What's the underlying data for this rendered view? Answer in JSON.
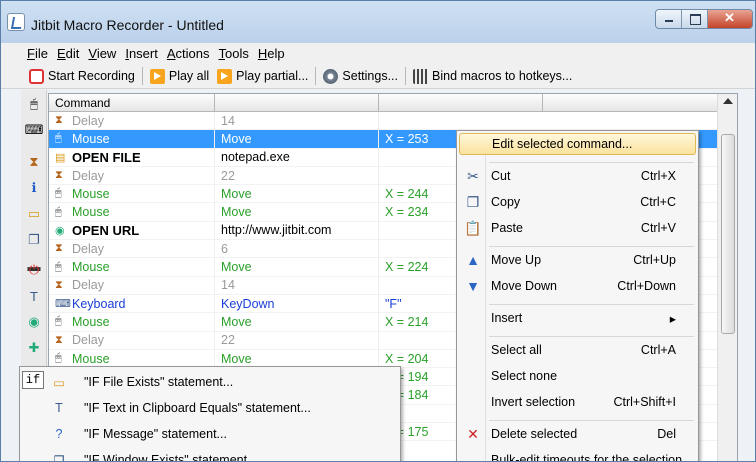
{
  "window": {
    "title": "Jitbit Macro Recorder - Untitled"
  },
  "menu": [
    "File",
    "Edit",
    "View",
    "Insert",
    "Actions",
    "Tools",
    "Help"
  ],
  "toolbar": {
    "start": "Start Recording",
    "play_all": "Play all",
    "play_partial": "Play partial...",
    "settings": "Settings...",
    "bind": "Bind macros to hotkeys..."
  },
  "grid": {
    "header": "Command",
    "rows": [
      {
        "icon": "hourglass-icon",
        "cmd": "Delay",
        "val": "14",
        "extra": "",
        "style": "gray"
      },
      {
        "icon": "mouse-icon",
        "cmd": "Mouse",
        "val": "Move",
        "extra": "X = 253",
        "style": "green",
        "selected": true
      },
      {
        "icon": "folder-icon",
        "cmd": "OPEN FILE",
        "val": "notepad.exe",
        "extra": "",
        "style": "bold"
      },
      {
        "icon": "hourglass-icon",
        "cmd": "Delay",
        "val": "22",
        "extra": "",
        "style": "gray"
      },
      {
        "icon": "mouse-icon",
        "cmd": "Mouse",
        "val": "Move",
        "extra": "X = 244",
        "style": "green"
      },
      {
        "icon": "mouse-icon",
        "cmd": "Mouse",
        "val": "Move",
        "extra": "X = 234",
        "style": "green"
      },
      {
        "icon": "globe-icon",
        "cmd": "OPEN URL",
        "val": "http://www.jitbit.com",
        "extra": "",
        "style": "bold"
      },
      {
        "icon": "hourglass-icon",
        "cmd": "Delay",
        "val": "6",
        "extra": "",
        "style": "gray"
      },
      {
        "icon": "mouse-icon",
        "cmd": "Mouse",
        "val": "Move",
        "extra": "X = 224",
        "style": "green"
      },
      {
        "icon": "hourglass-icon",
        "cmd": "Delay",
        "val": "14",
        "extra": "",
        "style": "gray"
      },
      {
        "icon": "keyboard-icon",
        "cmd": "Keyboard",
        "val": "KeyDown",
        "extra": "\"F\"",
        "style": "blue"
      },
      {
        "icon": "mouse-icon",
        "cmd": "Mouse",
        "val": "Move",
        "extra": "X = 214",
        "style": "green"
      },
      {
        "icon": "hourglass-icon",
        "cmd": "Delay",
        "val": "22",
        "extra": "",
        "style": "gray"
      },
      {
        "icon": "mouse-icon",
        "cmd": "Mouse",
        "val": "Move",
        "extra": "X = 204",
        "style": "green"
      },
      {
        "icon": "",
        "cmd": "",
        "val": "",
        "extra": "X = 194",
        "style": "green",
        "hidden": true
      },
      {
        "icon": "",
        "cmd": "",
        "val": "",
        "extra": "X = 184",
        "style": "green",
        "hidden": true
      },
      {
        "icon": "",
        "cmd": "",
        "val": "",
        "extra": "",
        "style": "green",
        "hidden": true
      },
      {
        "icon": "",
        "cmd": "",
        "val": "",
        "extra": "X = 175",
        "style": "green",
        "hidden": true
      }
    ]
  },
  "context_menu": [
    {
      "label": "Edit selected command...",
      "shortcut": "",
      "icon": "",
      "hl": true
    },
    {
      "sep": true
    },
    {
      "label": "Cut",
      "shortcut": "Ctrl+X",
      "icon": "scissors-icon"
    },
    {
      "label": "Copy",
      "shortcut": "Ctrl+C",
      "icon": "copy-icon"
    },
    {
      "label": "Paste",
      "shortcut": "Ctrl+V",
      "icon": "paste-icon"
    },
    {
      "sep": true
    },
    {
      "label": "Move Up",
      "shortcut": "Ctrl+Up",
      "icon": "arrow-up-icon"
    },
    {
      "label": "Move Down",
      "shortcut": "Ctrl+Down",
      "icon": "arrow-down-icon"
    },
    {
      "sep": true
    },
    {
      "label": "Insert",
      "shortcut": "▸",
      "icon": ""
    },
    {
      "sep": true
    },
    {
      "label": "Select all",
      "shortcut": "Ctrl+A",
      "icon": ""
    },
    {
      "label": "Select none",
      "shortcut": "",
      "icon": ""
    },
    {
      "label": "Invert selection",
      "shortcut": "Ctrl+Shift+I",
      "icon": ""
    },
    {
      "sep": true
    },
    {
      "label": "Delete selected",
      "shortcut": "Del",
      "icon": "delete-x-icon"
    },
    {
      "label": "Bulk-edit timeouts for the selection",
      "shortcut": "",
      "icon": ""
    }
  ],
  "submenu": {
    "tag": "if",
    "items": [
      "\"IF File Exists\" statement...",
      "\"IF Text in Clipboard Equals\" statement...",
      "\"IF Message\" statement...",
      "\"IF Window Exists\" statement..."
    ]
  },
  "colors": {
    "selection": "#3399ff",
    "move": "#2aa02a",
    "keyboard": "#1a3fd9",
    "delay": "#9a9a9a"
  }
}
